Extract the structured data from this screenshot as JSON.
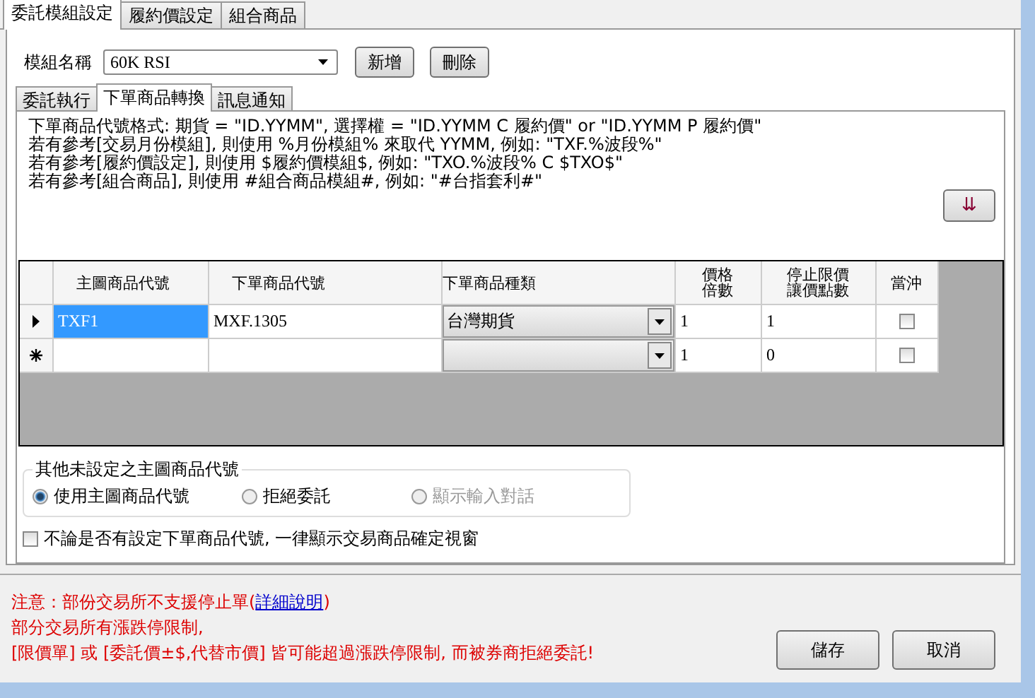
{
  "tabs": [
    {
      "label": "委託模組設定",
      "selected": true
    },
    {
      "label": "履約價設定",
      "selected": false
    },
    {
      "label": "組合商品",
      "selected": false
    }
  ],
  "module": {
    "label": "模組名稱",
    "value": "60K RSI",
    "buttons": [
      "新增",
      "刪除"
    ]
  },
  "sub_tabs": [
    {
      "label": "委託執行",
      "selected": false
    },
    {
      "label": "下單商品轉換",
      "selected": true
    },
    {
      "label": "訊息通知",
      "selected": false
    }
  ],
  "info_lines": [
    "下單商品代號格式: 期貨 = \"ID.YYMM\", 選擇權 = \"ID.YYMM C 履約價\" or \"ID.YYMM P 履約價\"",
    "若有參考[交易月份模組], 則使用  %月份模組% 來取代 YYMM, 例如: \"TXF.%波段%\"",
    "若有參考[履約價設定], 則使用 $履約價模組$, 例如: \"TXO.%波段% C $TXO$\"",
    "若有參考[組合商品], 則使用 #組合商品模組#, 例如: \"#台指套利#\""
  ],
  "move_down_button": "⇊",
  "table": {
    "columns": [
      "主圖商品代號",
      "下單商品代號",
      "下單商品種類",
      "價格倍數",
      "停止限價讓價點數",
      "當沖"
    ],
    "rows": [
      {
        "kind": "current",
        "main_code": "TXF1",
        "order_code": "MXF.1305",
        "type": "台灣期貨",
        "multiplier": "1",
        "stop_points": "1",
        "day_trade": false,
        "selected": true
      },
      {
        "kind": "new",
        "main_code": "",
        "order_code": "",
        "type": "",
        "multiplier": "1",
        "stop_points": "0",
        "day_trade": false,
        "selected": false
      }
    ]
  },
  "fallback": {
    "legend": "其他未設定之主圖商品代號",
    "options": [
      {
        "label": "使用主圖商品代號",
        "selected": true,
        "disabled": false
      },
      {
        "label": "拒絕委託",
        "selected": false,
        "disabled": false
      },
      {
        "label": "顯示輸入對話",
        "selected": false,
        "disabled": true
      }
    ]
  },
  "always_confirm": {
    "label": "不論是否有設定下單商品代號, 一律顯示交易商品確定視窗",
    "checked": false
  },
  "notice": {
    "line1": "注意：部份交易所不支援停止單(",
    "link": "詳細說明",
    "line1_end": ")",
    "line2": "部分交易所有漲跌停限制,",
    "line3": "[限價單] 或 [委託價±$,代替市價] 皆可能超過漲跌停限制, 而被券商拒絕委託!"
  },
  "footer_buttons": [
    "儲存",
    "取消"
  ]
}
